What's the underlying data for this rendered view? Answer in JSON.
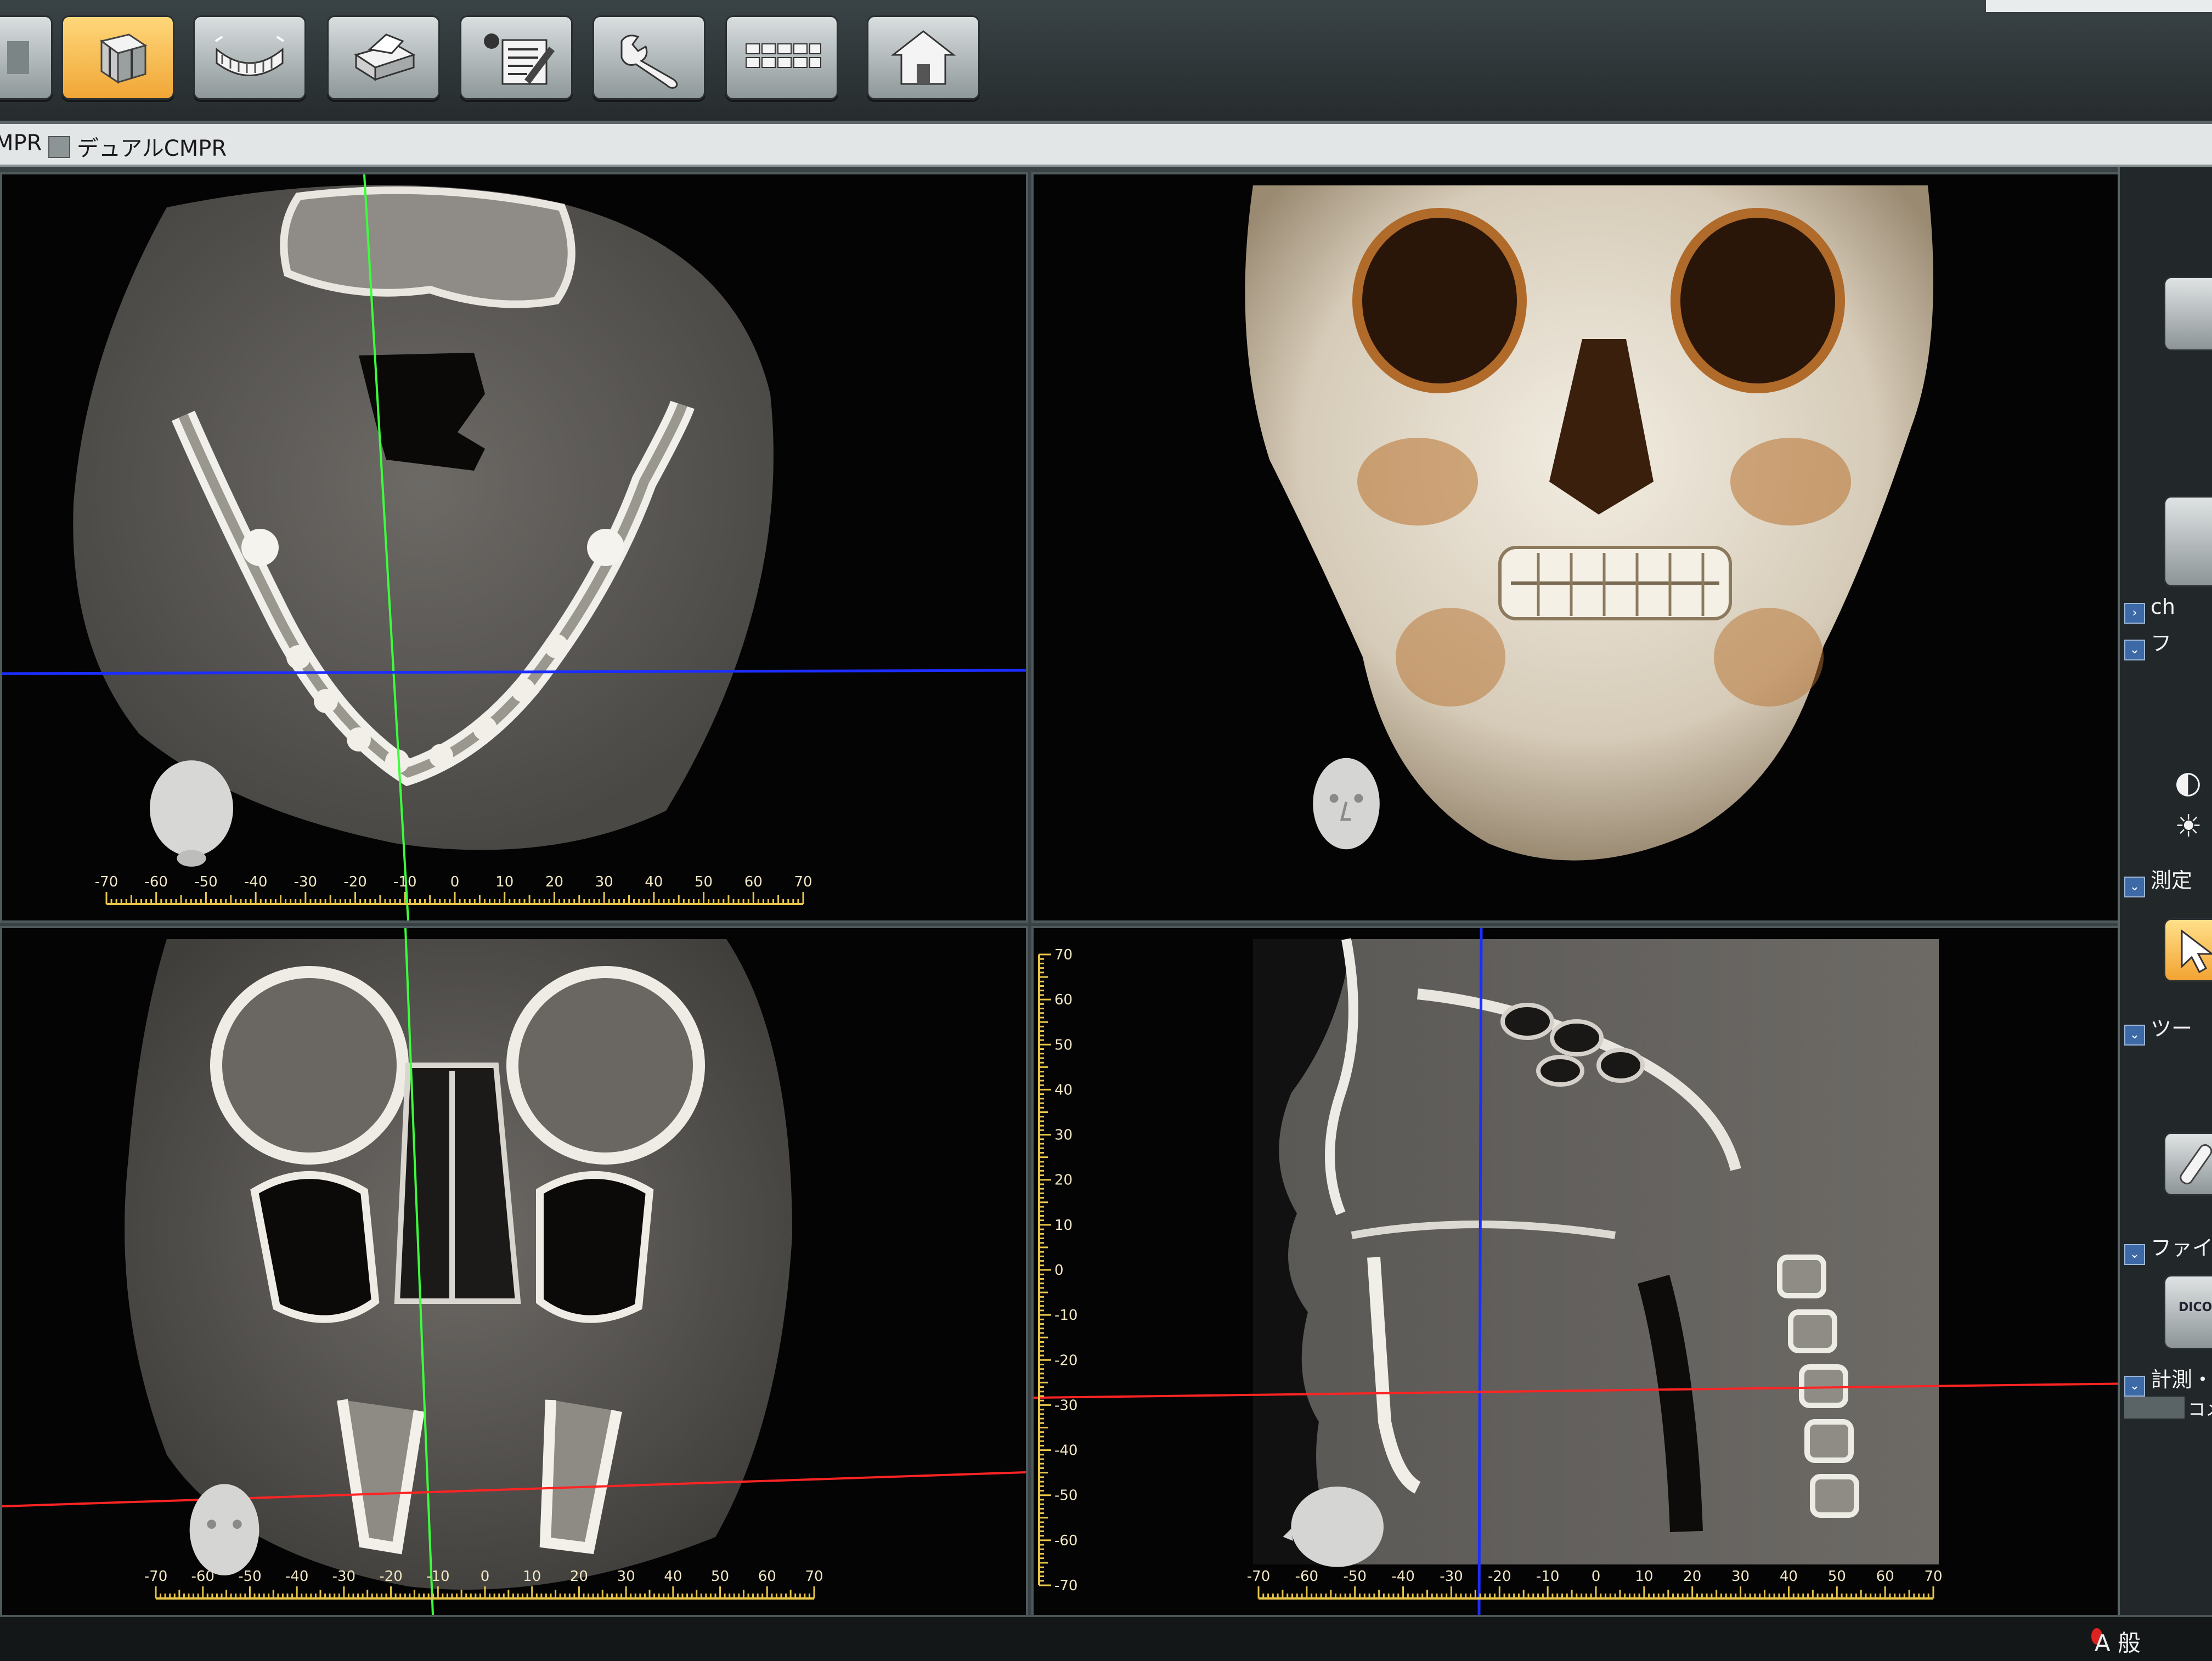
{
  "toolbar": {
    "buttons": [
      {
        "icon": "view-icon-partial"
      },
      {
        "icon": "volume-cube-icon",
        "active": true
      },
      {
        "icon": "panoramic-jaw-icon"
      },
      {
        "icon": "print-icon"
      },
      {
        "icon": "report-edit-icon"
      },
      {
        "icon": "wrench-icon"
      },
      {
        "icon": "grid-layout-icon"
      },
      {
        "icon": "home-icon"
      }
    ]
  },
  "tabs": [
    {
      "label": "MPR"
    },
    {
      "label": "デュアルCMPR"
    }
  ],
  "viewports": {
    "axial": {
      "scale_labels": [
        "-70",
        "-60",
        "-50",
        "-40",
        "-30",
        "-20",
        "-10",
        "0",
        "10",
        "20",
        "30",
        "40",
        "50",
        "60",
        "70"
      ]
    },
    "volume_3d": {},
    "coronal": {
      "scale_labels": [
        "-70",
        "-60",
        "-50",
        "-40",
        "-30",
        "-20",
        "-10",
        "0",
        "10",
        "20",
        "30",
        "40",
        "50",
        "60",
        "70"
      ]
    },
    "sagittal": {
      "scale_labels": [
        "-70",
        "-60",
        "-50",
        "-40",
        "-30",
        "-20",
        "-10",
        "0",
        "10",
        "20",
        "30",
        "40",
        "50",
        "60",
        "70"
      ],
      "vertical_scale_labels": [
        "70",
        "60",
        "50",
        "40",
        "30",
        "20",
        "10",
        "0",
        "-10",
        "-20",
        "-30",
        "-40",
        "-50",
        "-60",
        "-70"
      ]
    }
  },
  "right_panel": {
    "rows": [
      {
        "label": "ch"
      },
      {
        "label": "フ"
      },
      {
        "label": "測定"
      },
      {
        "label": "ツー"
      },
      {
        "label": "ファイ"
      },
      {
        "label": "計測・ア"
      },
      {
        "label": "コメ"
      }
    ],
    "dicom_label": "DICOM"
  },
  "status": {
    "ime_text": "A 般"
  },
  "colors": {
    "accent_active": "#f0a636",
    "crosshair_green": "#3cff3c",
    "crosshair_blue": "#1c2dff",
    "crosshair_red": "#ff2424",
    "scale_yellow": "#e8c64a"
  }
}
